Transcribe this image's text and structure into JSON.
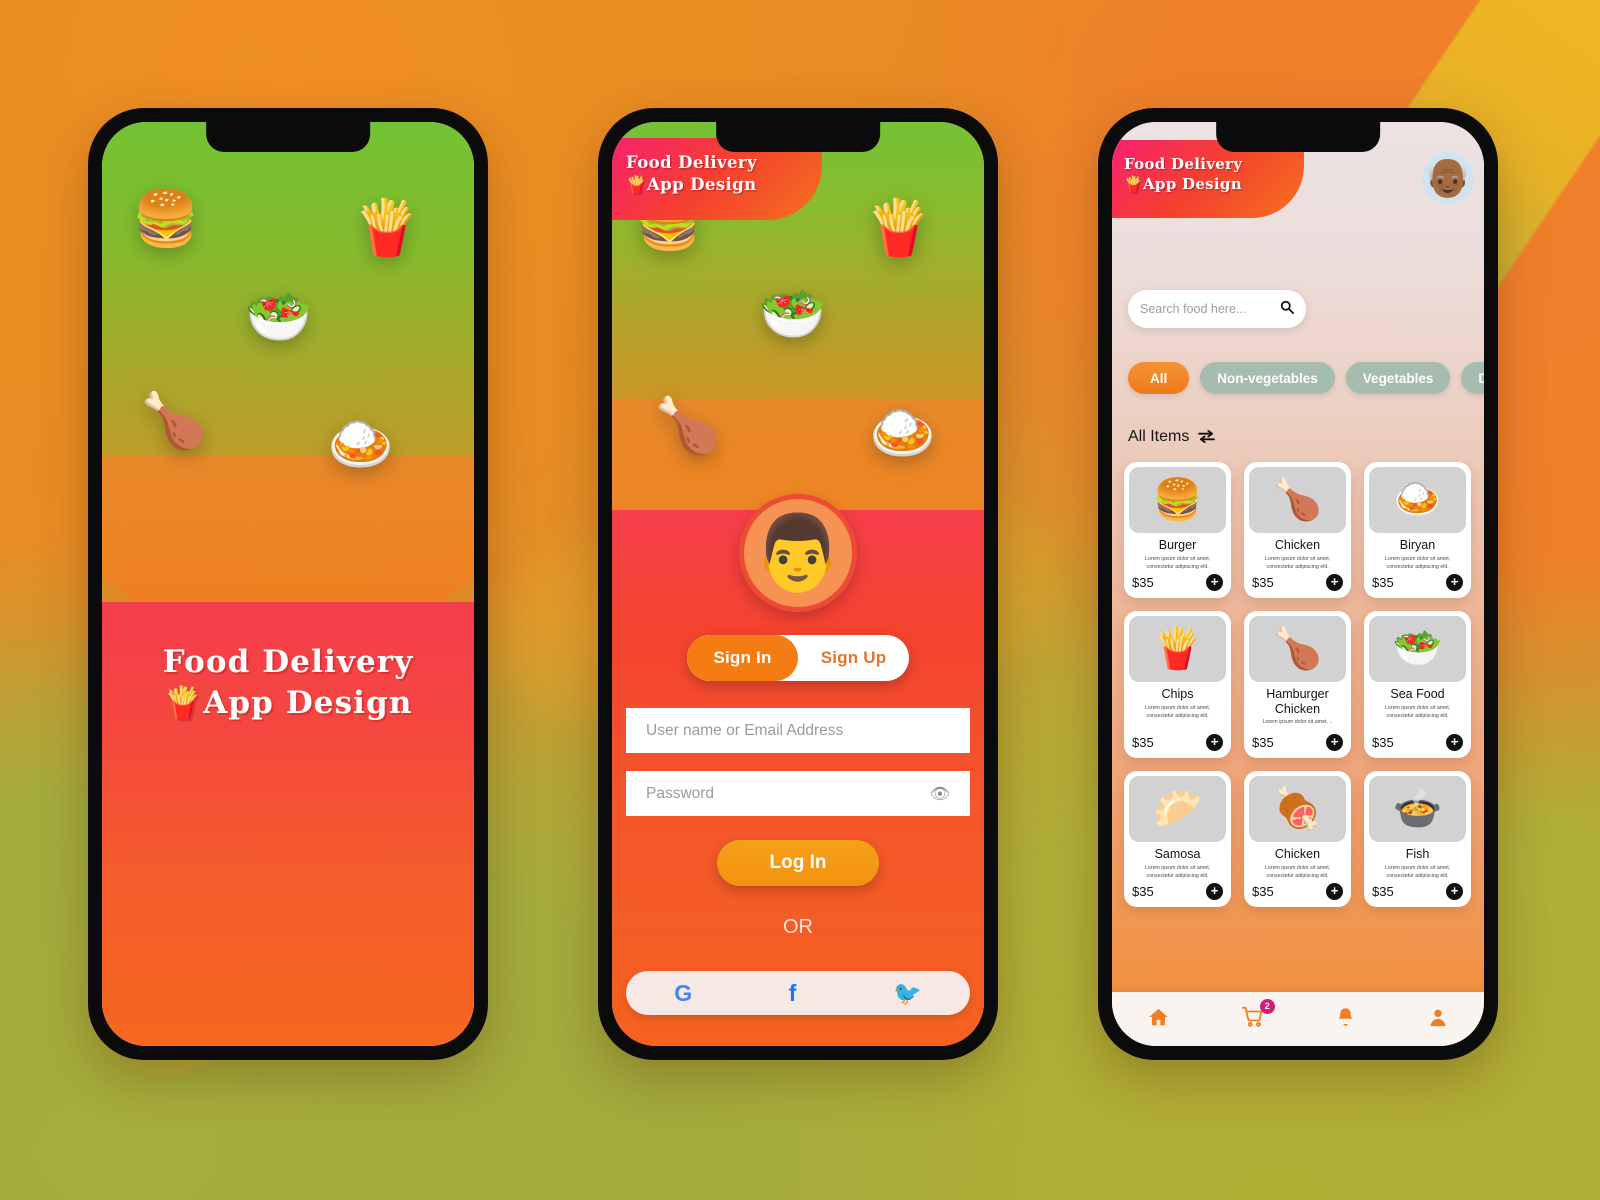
{
  "app": {
    "brand_line1": "Food Delivery",
    "brand_line2": "App Design",
    "brand_emoji": "🍟"
  },
  "splash": {
    "title_line1": "Food Delivery",
    "title_line2": "App Design",
    "title_emoji": "🍟",
    "foods": [
      {
        "name": "burger",
        "emoji": "🍔"
      },
      {
        "name": "fries",
        "emoji": "🍟"
      },
      {
        "name": "salad",
        "emoji": "🥗"
      },
      {
        "name": "roast-chicken",
        "emoji": "🍗"
      },
      {
        "name": "biryani",
        "emoji": "🍛"
      }
    ]
  },
  "login": {
    "brand_line1": "Food Delivery",
    "brand_line2": "App Design",
    "avatar_emoji": "👨",
    "tab_signin": "Sign In",
    "tab_signup": "Sign Up",
    "username_placeholder": "User name or Email Address",
    "username_value": "",
    "password_placeholder": "Password",
    "password_value": "",
    "eye_icon": "👁",
    "login_button": "Log In",
    "or_text": "OR",
    "social": [
      {
        "name": "google-login",
        "label": "G"
      },
      {
        "name": "facebook-login",
        "label": "f"
      },
      {
        "name": "twitter-login",
        "label": "🐦"
      }
    ]
  },
  "home": {
    "brand_line1": "Food Delivery",
    "brand_line2": "App Design",
    "avatar_emoji": "👴🏾",
    "search_placeholder": "Search food here...",
    "search_value": "",
    "search_icon": "🔍",
    "chips": [
      {
        "label": "All",
        "active": true
      },
      {
        "label": "Non-vegetables",
        "active": false
      },
      {
        "label": "Vegetables",
        "active": false
      },
      {
        "label": "Drinks",
        "active": false
      }
    ],
    "section_title": "All Items",
    "sort_icon": "⇄",
    "add_icon": "+",
    "items": [
      {
        "name": "Burger",
        "desc": "Lorem ipsum dolor sit amet, consectetur adipiscing elit.",
        "price": "$35",
        "emoji": "🍔"
      },
      {
        "name": "Chicken",
        "desc": "Lorem ipsum dolor sit amet, consectetur adipiscing elit.",
        "price": "$35",
        "emoji": "🍗"
      },
      {
        "name": "Biryan",
        "desc": "Lorem ipsum dolor sit amet, consectetur adipiscing elit.",
        "price": "$35",
        "emoji": "🍛"
      },
      {
        "name": "Chips",
        "desc": "Lorem ipsum dolor sit amet, consectetur adipiscing elit.",
        "price": "$35",
        "emoji": "🍟"
      },
      {
        "name": "Hamburger Chicken",
        "desc": "Lorem ipsum dolor sit amet, ..",
        "price": "$35",
        "emoji": "🍗"
      },
      {
        "name": "Sea Food",
        "desc": "Lorem ipsum dolor sit amet, consectetur adipiscing elit.",
        "price": "$35",
        "emoji": "🥗"
      },
      {
        "name": "Samosa",
        "desc": "Lorem ipsum dolor sit amet, consectetur adipiscing elit.",
        "price": "$35",
        "emoji": "🥟"
      },
      {
        "name": "Chicken",
        "desc": "Lorem ipsum dolor sit amet, consectetur adipiscing elit.",
        "price": "$35",
        "emoji": "🍖"
      },
      {
        "name": "Fish",
        "desc": "Lorem ipsum dolor sit amet, consectetur adipiscing elit.",
        "price": "$35",
        "emoji": "🍲"
      }
    ],
    "nav": [
      {
        "name": "home",
        "icon": "🏠",
        "badge": ""
      },
      {
        "name": "cart",
        "icon": "🛒",
        "badge": "2"
      },
      {
        "name": "notifications",
        "icon": "🔔",
        "badge": ""
      },
      {
        "name": "profile",
        "icon": "👤",
        "badge": ""
      }
    ]
  },
  "colors": {
    "accent_orange": "#f57c12",
    "accent_red": "#f4472f",
    "accent_pink": "#f8216e",
    "chip_inactive": "#a6bcae",
    "badge_pink": "#d81b72"
  }
}
